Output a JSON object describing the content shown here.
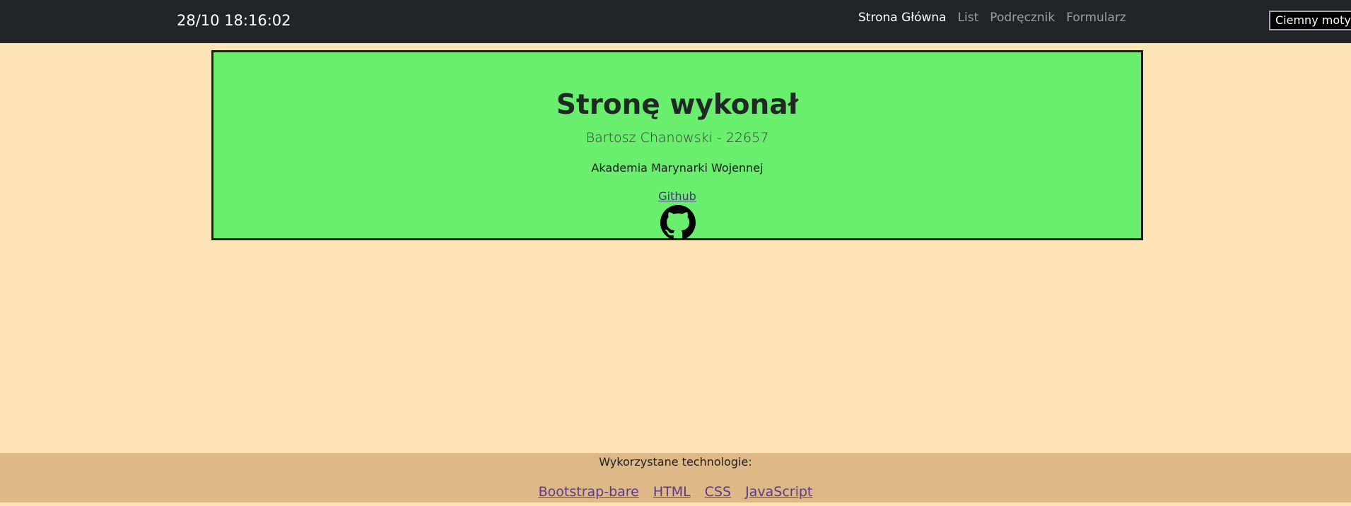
{
  "header": {
    "clock": "28/10 18:16:02",
    "nav": [
      {
        "label": "Strona Główna",
        "active": true
      },
      {
        "label": "List",
        "active": false
      },
      {
        "label": "Podręcznik",
        "active": false
      },
      {
        "label": "Formularz",
        "active": false
      }
    ],
    "theme_button": "Ciemny motyw"
  },
  "card": {
    "title": "Stronę wykonał",
    "author": "Bartosz Chanowski - 22657",
    "school": "Akademia Marynarki Wojennej",
    "link_label": "Github",
    "icon": "github-icon"
  },
  "footer": {
    "title": "Wykorzystane technologie:",
    "links": [
      "Bootstrap-bare",
      "HTML",
      "CSS",
      "JavaScript"
    ]
  },
  "colors": {
    "navbar": "#212529",
    "page_background": "#ffe4b8",
    "card_background": "#6aee6e",
    "footer_background": "#deb887"
  }
}
